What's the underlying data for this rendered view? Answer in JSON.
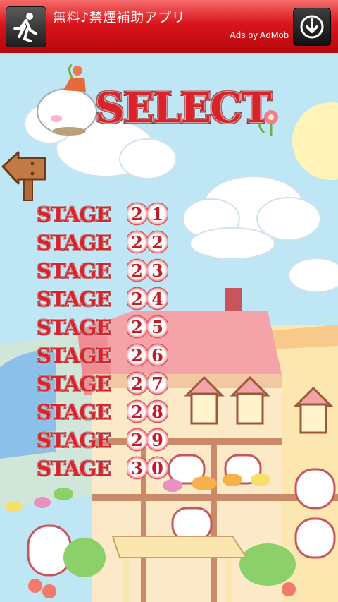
{
  "ad": {
    "title": "無料♪禁煙補助アプリ",
    "attribution": "Ads by AdMob"
  },
  "header": {
    "title": "SELECT"
  },
  "stages": [
    {
      "word": "STAGE",
      "number": "21"
    },
    {
      "word": "STAGE",
      "number": "22"
    },
    {
      "word": "STAGE",
      "number": "23"
    },
    {
      "word": "STAGE",
      "number": "24"
    },
    {
      "word": "STAGE",
      "number": "25"
    },
    {
      "word": "STAGE",
      "number": "26"
    },
    {
      "word": "STAGE",
      "number": "27"
    },
    {
      "word": "STAGE",
      "number": "28"
    },
    {
      "word": "STAGE",
      "number": "29"
    },
    {
      "word": "STAGE",
      "number": "30"
    }
  ],
  "colors": {
    "ad_red": "#d9151c",
    "sky": "#bfe6f5",
    "stage_red": "#d8232a"
  }
}
